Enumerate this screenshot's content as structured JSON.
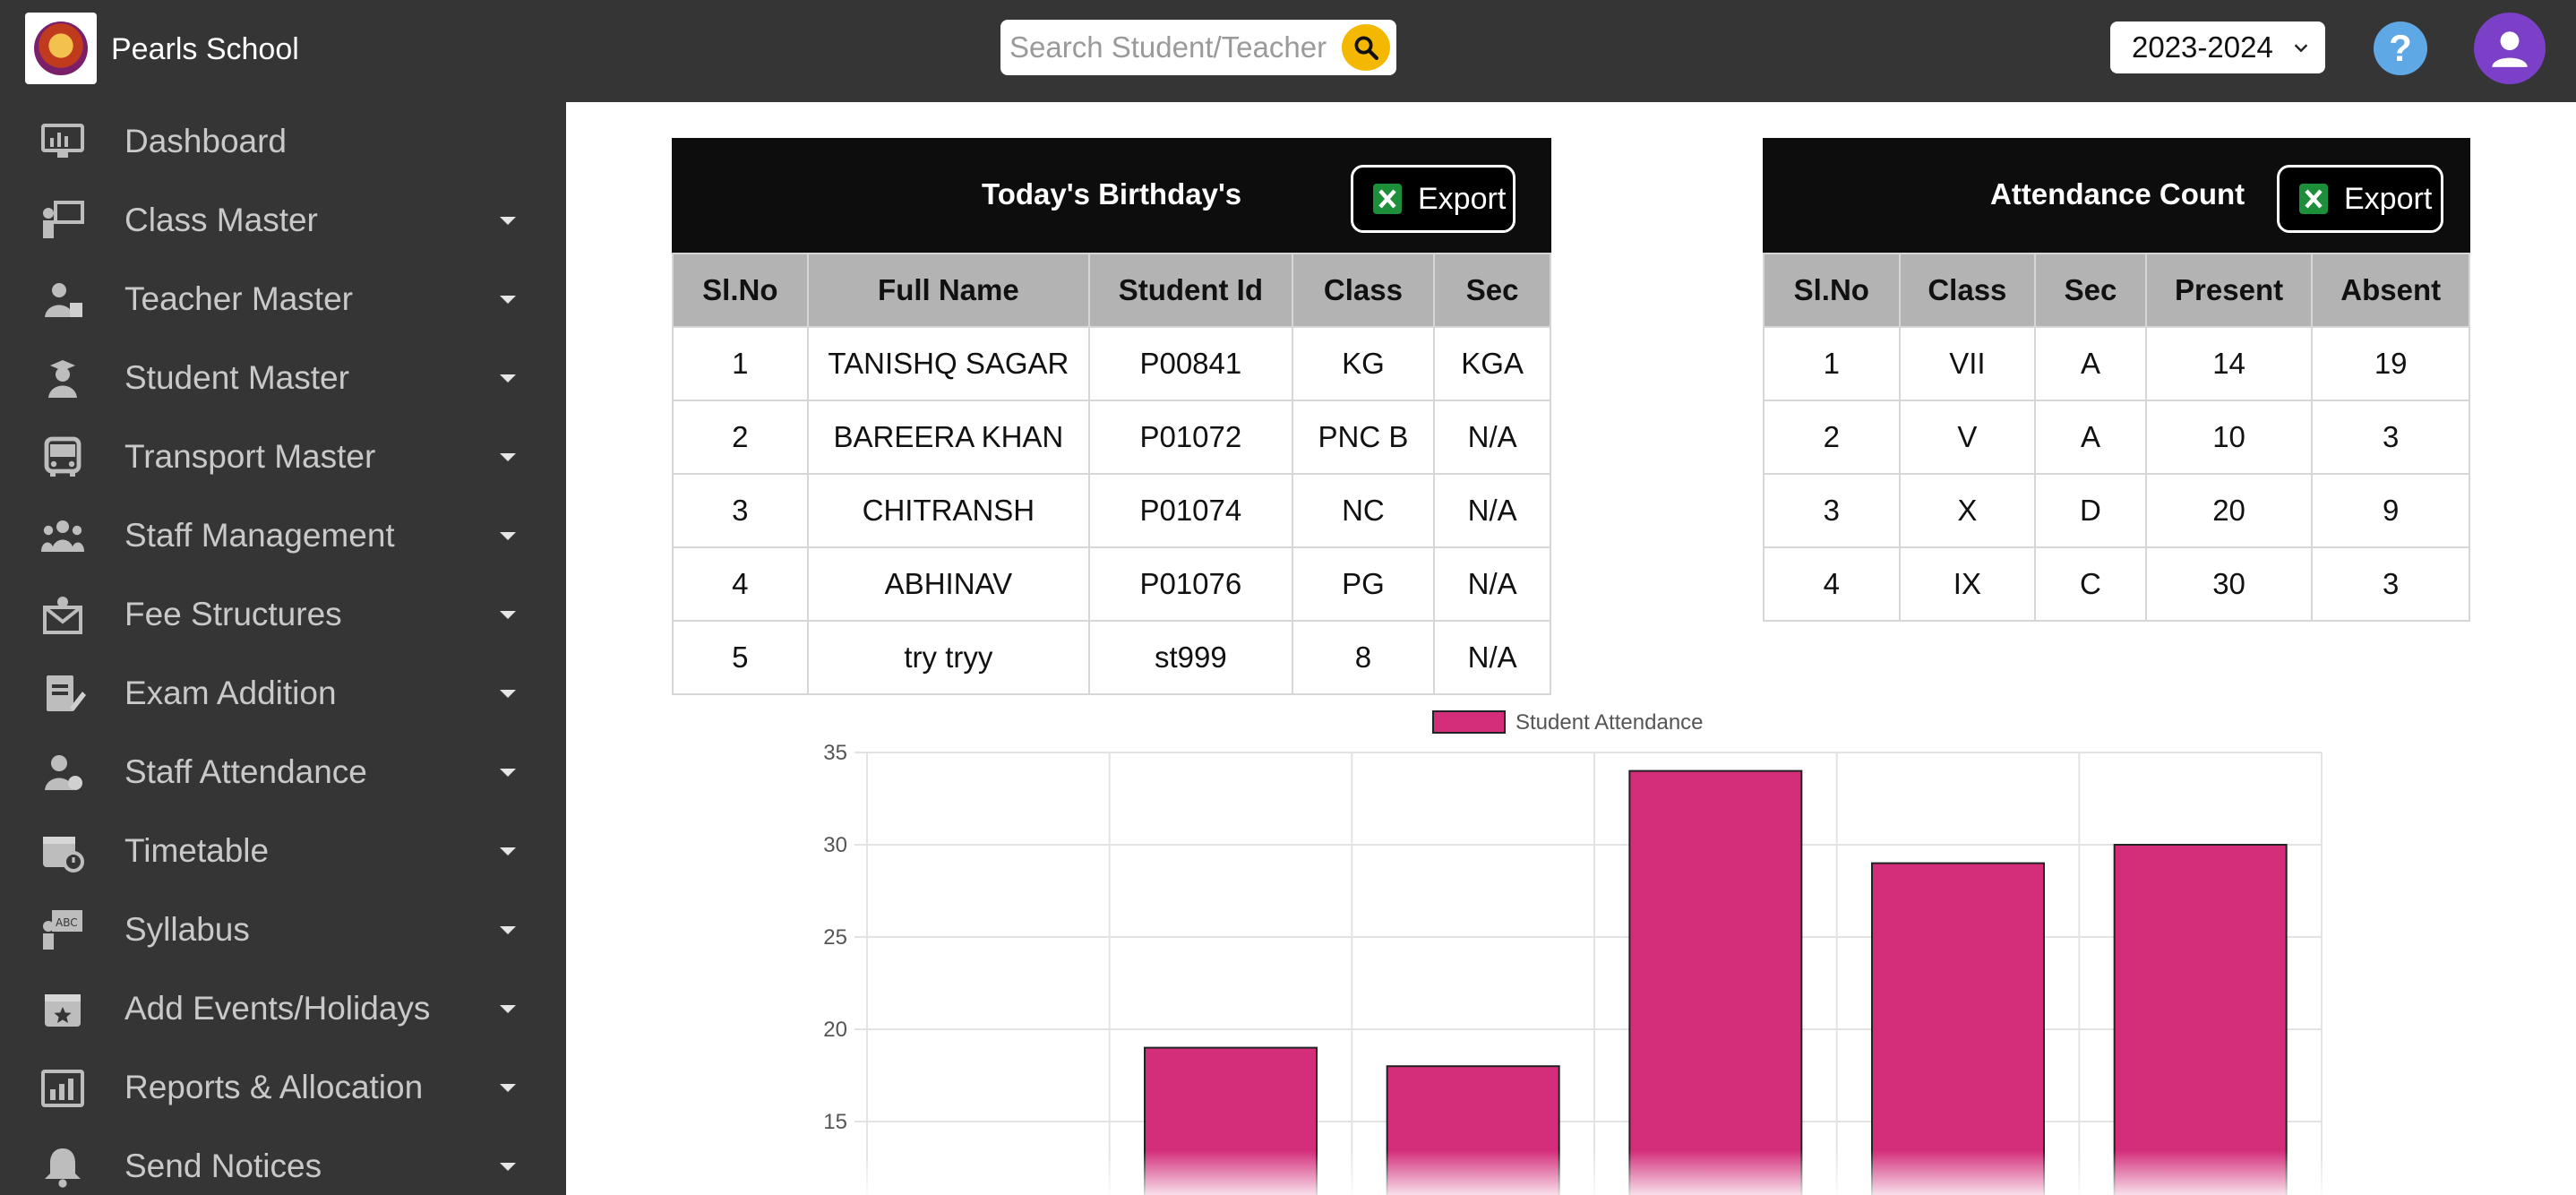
{
  "app": {
    "school_name": "Pearls School",
    "search_placeholder": "Search Student/Teacher",
    "academic_year": "2023-2024",
    "help_label": "?"
  },
  "sidebar": {
    "items": [
      {
        "label": "Dashboard",
        "icon": "dashboard-icon",
        "has_caret": false
      },
      {
        "label": "Class Master",
        "icon": "class-master-icon",
        "has_caret": true
      },
      {
        "label": "Teacher Master",
        "icon": "teacher-master-icon",
        "has_caret": true
      },
      {
        "label": "Student Master",
        "icon": "student-master-icon",
        "has_caret": true
      },
      {
        "label": "Transport Master",
        "icon": "bus-icon",
        "has_caret": true
      },
      {
        "label": "Staff Management",
        "icon": "staff-group-icon",
        "has_caret": true
      },
      {
        "label": "Fee Structures",
        "icon": "fee-icon",
        "has_caret": true
      },
      {
        "label": "Exam Addition",
        "icon": "exam-icon",
        "has_caret": true
      },
      {
        "label": "Staff Attendance",
        "icon": "staff-attendance-icon",
        "has_caret": true
      },
      {
        "label": "Timetable",
        "icon": "calendar-clock-icon",
        "has_caret": true
      },
      {
        "label": "Syllabus",
        "icon": "syllabus-board-icon",
        "has_caret": true
      },
      {
        "label": "Add Events/Holidays",
        "icon": "calendar-star-icon",
        "has_caret": true
      },
      {
        "label": "Reports & Allocation",
        "icon": "report-chart-icon",
        "has_caret": true
      },
      {
        "label": "Send Notices",
        "icon": "bell-icon",
        "has_caret": true
      }
    ]
  },
  "birthdays": {
    "title": "Today's Birthday's",
    "export_label": "Export",
    "columns": [
      "Sl.No",
      "Full Name",
      "Student Id",
      "Class",
      "Sec"
    ],
    "rows": [
      [
        "1",
        "TANISHQ SAGAR",
        "P00841",
        "KG",
        "KGA"
      ],
      [
        "2",
        "BAREERA KHAN",
        "P01072",
        "PNC B",
        "N/A"
      ],
      [
        "3",
        "CHITRANSH",
        "P01074",
        "NC",
        "N/A"
      ],
      [
        "4",
        "ABHINAV",
        "P01076",
        "PG",
        "N/A"
      ],
      [
        "5",
        "try tryy",
        "st999",
        "8",
        "N/A"
      ]
    ]
  },
  "attendance": {
    "title": "Attendance Count",
    "export_label": "Export",
    "columns": [
      "Sl.No",
      "Class",
      "Sec",
      "Present",
      "Absent"
    ],
    "rows": [
      [
        "1",
        "VII",
        "A",
        "14",
        "19"
      ],
      [
        "2",
        "V",
        "A",
        "10",
        "3"
      ],
      [
        "3",
        "X",
        "D",
        "20",
        "9"
      ],
      [
        "4",
        "IX",
        "C",
        "30",
        "3"
      ]
    ]
  },
  "chart_data": {
    "type": "bar",
    "legend_position": "top",
    "grid": true,
    "series": [
      {
        "name": "Student Attendance",
        "color": "#d42d7a",
        "values": [
          null,
          19,
          18,
          34,
          29,
          30
        ]
      }
    ],
    "y_ticks": [
      "35",
      "30",
      "25",
      "20",
      "15"
    ],
    "ylim": [
      10,
      35
    ]
  }
}
